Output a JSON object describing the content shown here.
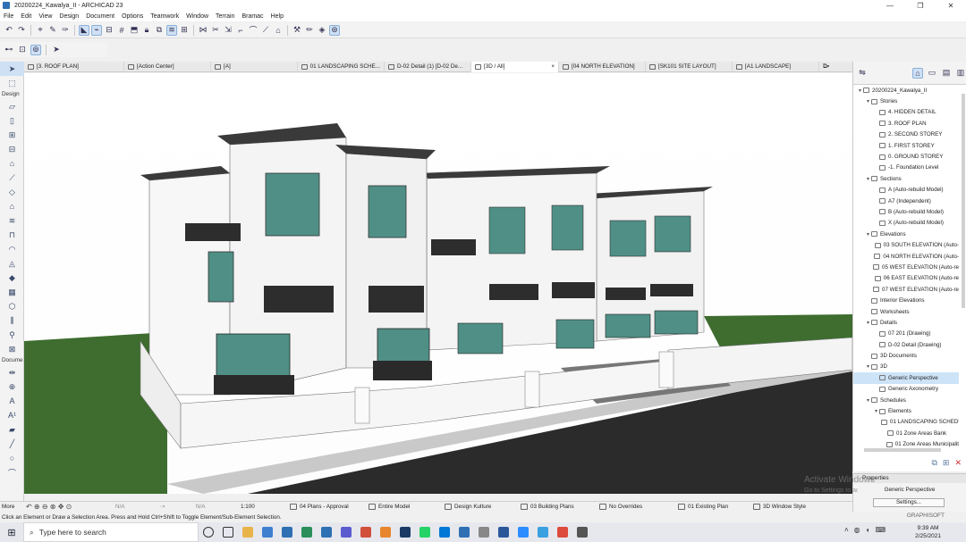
{
  "window": {
    "title": "20200224_Kawalya_II - ARCHICAD 23",
    "controls": [
      "minimize",
      "restore",
      "close"
    ]
  },
  "menu": [
    "File",
    "Edit",
    "View",
    "Design",
    "Document",
    "Options",
    "Teamwork",
    "Window",
    "Terrain",
    "Bramac",
    "Help"
  ],
  "tabs": [
    {
      "label": "[3. ROOF PLAN]",
      "icon": "floor-plan-icon",
      "active": false
    },
    {
      "label": "[Action Center]",
      "icon": "action-center-icon",
      "active": false
    },
    {
      "label": "[A]",
      "icon": "section-icon",
      "active": false
    },
    {
      "label": "01 LANDSCAPING SCHE...",
      "icon": "schedule-icon",
      "active": false
    },
    {
      "label": "D-02 Detail (1) [D-02 De...",
      "icon": "detail-icon",
      "active": false
    },
    {
      "label": "[3D / All]",
      "icon": "3d-icon",
      "active": true,
      "close": "×"
    },
    {
      "label": "[04 NORTH ELEVATION]",
      "icon": "elevation-icon",
      "active": false
    },
    {
      "label": "[SK101 SITE LAYOUT]",
      "icon": "layout-icon",
      "active": false
    },
    {
      "label": "[A1 LANDSCAPE]",
      "icon": "layout-icon",
      "active": false
    }
  ],
  "toolbox": {
    "design_header": "Design",
    "document_header": "Docume",
    "more_label": "More"
  },
  "navigator": {
    "tree": [
      {
        "label": "20200224_Kawalya_II",
        "level": 0,
        "toggle": "▾",
        "icon": "project-icon"
      },
      {
        "label": "Stories",
        "level": 1,
        "toggle": "▾",
        "icon": "stories-icon"
      },
      {
        "label": "4. HIDDEN DETAIL",
        "level": 2,
        "toggle": "",
        "icon": "story-icon"
      },
      {
        "label": "3. ROOF PLAN",
        "level": 2,
        "toggle": "",
        "icon": "story-icon"
      },
      {
        "label": "2. SECOND STOREY",
        "level": 2,
        "toggle": "",
        "icon": "story-icon"
      },
      {
        "label": "1. FIRST STOREY",
        "level": 2,
        "toggle": "",
        "icon": "story-icon"
      },
      {
        "label": "0. GROUND STOREY",
        "level": 2,
        "toggle": "",
        "icon": "story-icon"
      },
      {
        "label": "-1. Foundation Level",
        "level": 2,
        "toggle": "",
        "icon": "story-icon"
      },
      {
        "label": "Sections",
        "level": 1,
        "toggle": "▾",
        "icon": "sections-icon"
      },
      {
        "label": "A (Auto-rebuild Model)",
        "level": 2,
        "toggle": "",
        "icon": "section-icon"
      },
      {
        "label": "A7 (Independent)",
        "level": 2,
        "toggle": "",
        "icon": "section-icon"
      },
      {
        "label": "B (Auto-rebuild Model)",
        "level": 2,
        "toggle": "",
        "icon": "section-icon"
      },
      {
        "label": "X (Auto-rebuild Model)",
        "level": 2,
        "toggle": "",
        "icon": "section-icon"
      },
      {
        "label": "Elevations",
        "level": 1,
        "toggle": "▾",
        "icon": "elevations-icon"
      },
      {
        "label": "03 SOUTH ELEVATION (Auto-",
        "level": 2,
        "toggle": "",
        "icon": "elevation-icon"
      },
      {
        "label": "04 NORTH ELEVATION (Auto-",
        "level": 2,
        "toggle": "",
        "icon": "elevation-icon"
      },
      {
        "label": "05 WEST ELEVATION (Auto-re",
        "level": 2,
        "toggle": "",
        "icon": "elevation-icon"
      },
      {
        "label": "06 EAST ELEVATION (Auto-re",
        "level": 2,
        "toggle": "",
        "icon": "elevation-icon"
      },
      {
        "label": "07 WEST ELEVATION (Auto-re",
        "level": 2,
        "toggle": "",
        "icon": "elevation-icon"
      },
      {
        "label": "Interior Elevations",
        "level": 1,
        "toggle": "",
        "icon": "interior-elevations-icon"
      },
      {
        "label": "Worksheets",
        "level": 1,
        "toggle": "",
        "icon": "worksheets-icon"
      },
      {
        "label": "Details",
        "level": 1,
        "toggle": "▾",
        "icon": "details-icon"
      },
      {
        "label": "07 201 (Drawing)",
        "level": 2,
        "toggle": "",
        "icon": "detail-icon"
      },
      {
        "label": "D-02 Detail (Drawing)",
        "level": 2,
        "toggle": "",
        "icon": "detail-icon"
      },
      {
        "label": "3D Documents",
        "level": 1,
        "toggle": "",
        "icon": "3d-documents-icon"
      },
      {
        "label": "3D",
        "level": 1,
        "toggle": "▾",
        "icon": "3d-icon"
      },
      {
        "label": "Generic Perspective",
        "level": 2,
        "toggle": "",
        "icon": "perspective-icon",
        "selected": true
      },
      {
        "label": "Generic Axonometry",
        "level": 2,
        "toggle": "",
        "icon": "axonometry-icon"
      },
      {
        "label": "Schedules",
        "level": 1,
        "toggle": "▾",
        "icon": "schedules-icon"
      },
      {
        "label": "Elements",
        "level": 2,
        "toggle": "▾",
        "icon": "elements-icon"
      },
      {
        "label": "01 LANDSCAPING SCHEDU",
        "level": 3,
        "toggle": "",
        "icon": "schedule-icon"
      },
      {
        "label": "01 Zone Areas Bank",
        "level": 3,
        "toggle": "",
        "icon": "schedule-icon"
      },
      {
        "label": "01 Zone Areas Municipalit",
        "level": 3,
        "toggle": "",
        "icon": "schedule-icon"
      }
    ]
  },
  "properties": {
    "header": "Properties",
    "value": "Generic Perspective",
    "settings_label": "Settings..."
  },
  "watermark": {
    "line1": "Activate Windows",
    "line2": "Go to Settings to activate Windows."
  },
  "quick_options": {
    "more": "More",
    "na1": "N/A",
    "na2": "N/A",
    "scale": "1:100",
    "view_set": "04 Plans - Approval",
    "model": "Entire Model",
    "design": "Design Kulture",
    "plans": "03 Building Plans",
    "overrides": "No Overrides",
    "phase": "01 Existing Plan",
    "style": "3D Window Style"
  },
  "status": {
    "message": "Click an Element or Draw a Selection Area. Press and Hold Ctrl+Shift to Toggle Element/Sub-Element Selection.",
    "brand": "GRAPHISOFT"
  },
  "taskbar": {
    "search_placeholder": "Type here to search",
    "apps": [
      "cortana-icon",
      "task-view-icon",
      "file-explorer-icon",
      "store-icon",
      "mail-icon",
      "browser-icon",
      "archicad-icon",
      "notes-icon",
      "calendar-icon",
      "vlc-icon",
      "photoshop-icon",
      "whatsapp-icon",
      "skype-icon",
      "edge-icon",
      "tools-icon",
      "word-icon",
      "zoom-icon",
      "edge-chromium-icon",
      "chrome-icon",
      "camera-icon"
    ],
    "time": "9:39 AM",
    "date": "2/25/2021"
  },
  "colors": {
    "accent": "#2f6fb3",
    "selection": "#cde3f7",
    "wall": "#f4f4f4",
    "roof": "#3a3a3a",
    "glass": "#4f8f86",
    "grass": "#3e6d2f",
    "road": "#2a2a2a"
  }
}
